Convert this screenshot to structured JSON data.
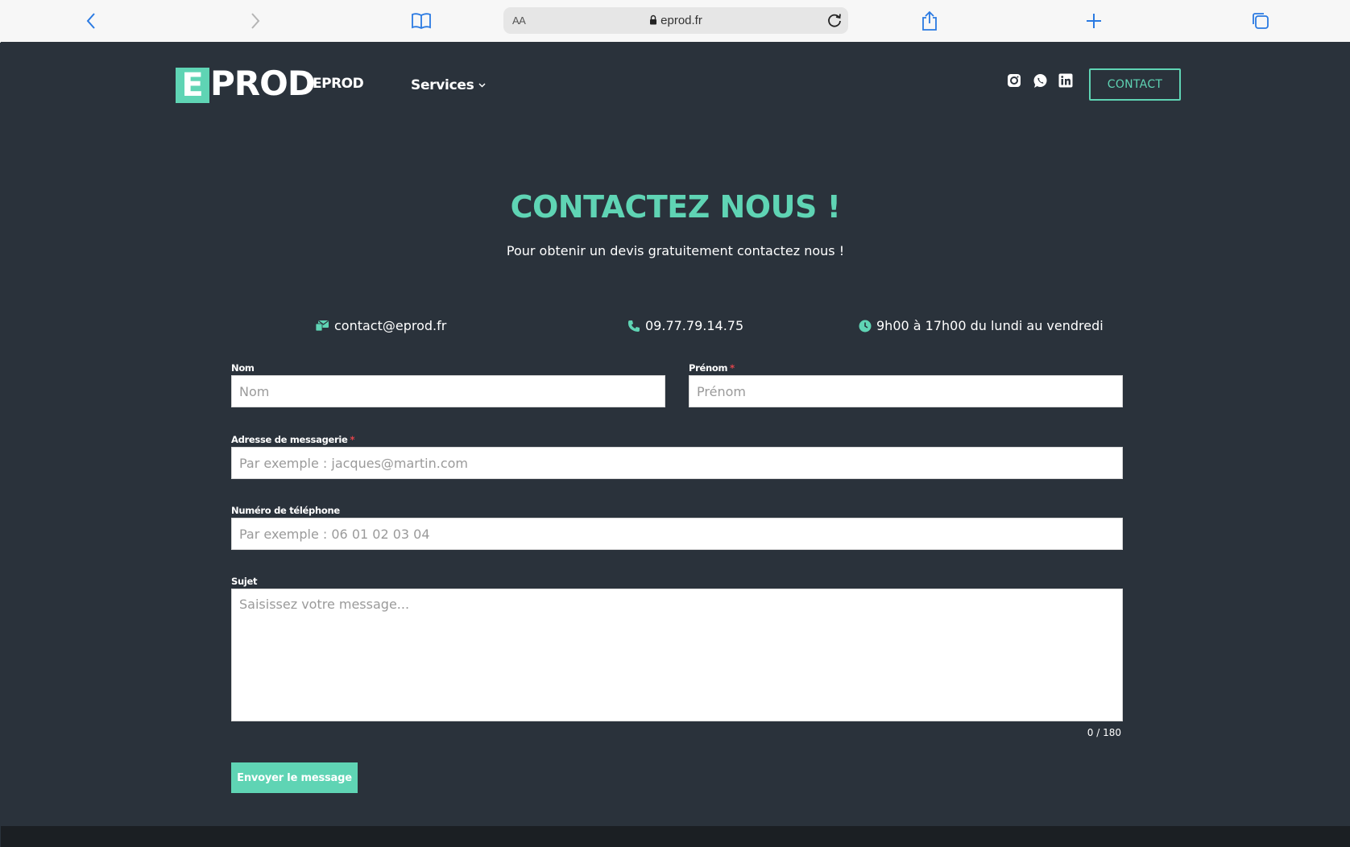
{
  "browser": {
    "text_size_label": "AA",
    "url": "eprod.fr"
  },
  "header": {
    "logo_letter": "E",
    "logo_word": "PROD",
    "brand_name": "EPROD",
    "nav_services": "Services",
    "contact_button": "CONTACT"
  },
  "hero": {
    "title": "CONTACTEZ NOUS !",
    "subtitle": "Pour obtenir un devis gratuitement contactez nous !"
  },
  "info": {
    "email": "contact@eprod.fr",
    "phone": "09.77.79.14.75",
    "hours": "9h00 à 17h00 du lundi au vendredi"
  },
  "form": {
    "nom_label": "Nom",
    "nom_placeholder": "Nom",
    "prenom_label": "Prénom",
    "prenom_placeholder": "Prénom",
    "email_label": "Adresse de messagerie",
    "email_placeholder": "Par exemple : jacques@martin.com",
    "phone_label": "Numéro de téléphone",
    "phone_placeholder": "Par exemple : 06 01 02 03 04",
    "subject_label": "Sujet",
    "subject_placeholder": "Saisissez votre message...",
    "required_mark": "*",
    "counter": "0 / 180",
    "submit": "Envoyer le message"
  },
  "colors": {
    "accent": "#5fd4b4",
    "page_bg": "#2a323b",
    "required": "#e0444b"
  }
}
